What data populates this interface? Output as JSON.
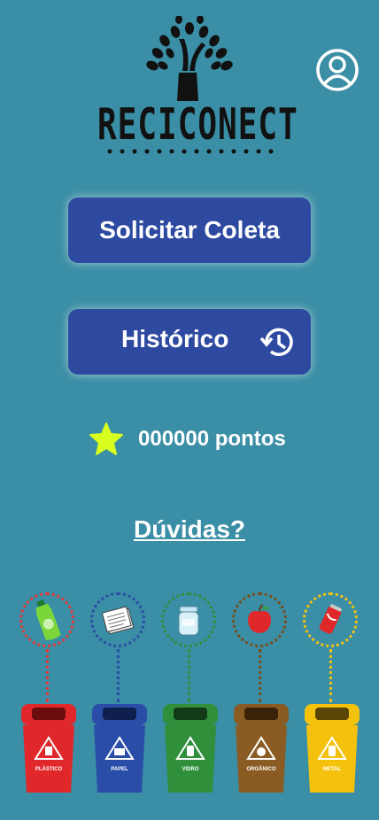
{
  "logo": {
    "name": "RECICONECT"
  },
  "buttons": {
    "solicitar": "Solicitar Coleta",
    "historico": "Histórico"
  },
  "points": {
    "text": "000000 pontos"
  },
  "help": {
    "label": "Dúvidas?"
  },
  "bins": [
    {
      "label": "PLÁSTICO",
      "color": "#e0282b",
      "dot": "#e23a3a"
    },
    {
      "label": "PAPEL",
      "color": "#2a4ea8",
      "dot": "#2a4ea8"
    },
    {
      "label": "VIDRO",
      "color": "#2f8f3b",
      "dot": "#2f8f3b"
    },
    {
      "label": "ORGÂNICO",
      "color": "#8a5b22",
      "dot": "#7a4d1c"
    },
    {
      "label": "METAL",
      "color": "#f4c20d",
      "dot": "#f4c20d"
    }
  ],
  "colors": {
    "background": "#3a8ea5",
    "button": "#2e4aa0",
    "star": "#d8ff1f"
  }
}
